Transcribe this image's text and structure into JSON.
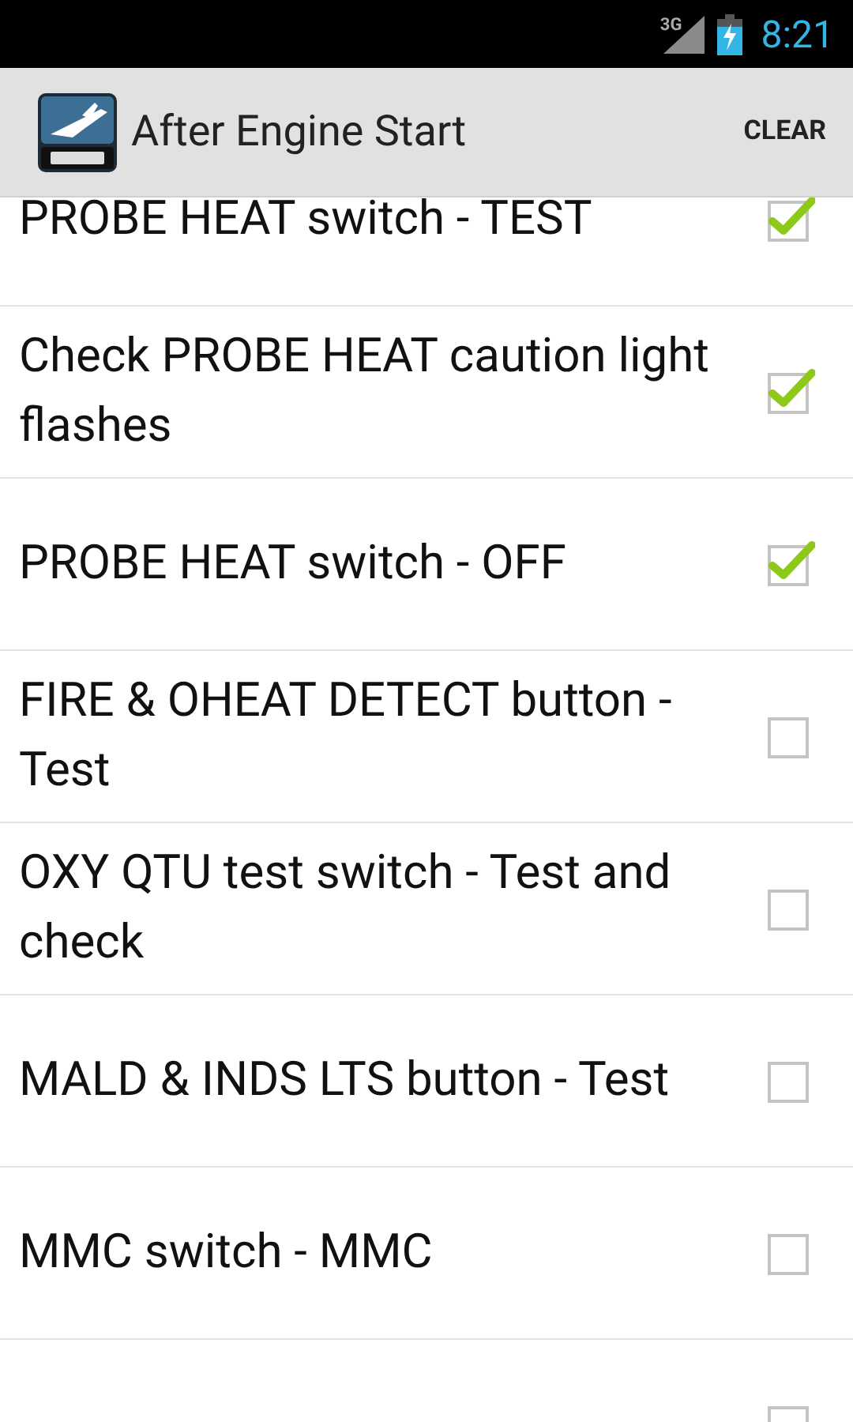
{
  "status_bar": {
    "network": "3G",
    "time": "8:21"
  },
  "action_bar": {
    "title": "After Engine Start",
    "action": "CLEAR"
  },
  "items": [
    {
      "label": "PROBE HEAT switch - TEST",
      "checked": true
    },
    {
      "label": "Check PROBE HEAT caution light flashes",
      "checked": true
    },
    {
      "label": "PROBE HEAT switch - OFF",
      "checked": true
    },
    {
      "label": "FIRE & OHEAT DETECT button - Test",
      "checked": false
    },
    {
      "label": "OXY QTU test switch - Test and check",
      "checked": false
    },
    {
      "label": "MALD & INDS LTS button - Test",
      "checked": false
    },
    {
      "label": "MMC switch - MMC",
      "checked": false
    },
    {
      "checked": false
    }
  ]
}
